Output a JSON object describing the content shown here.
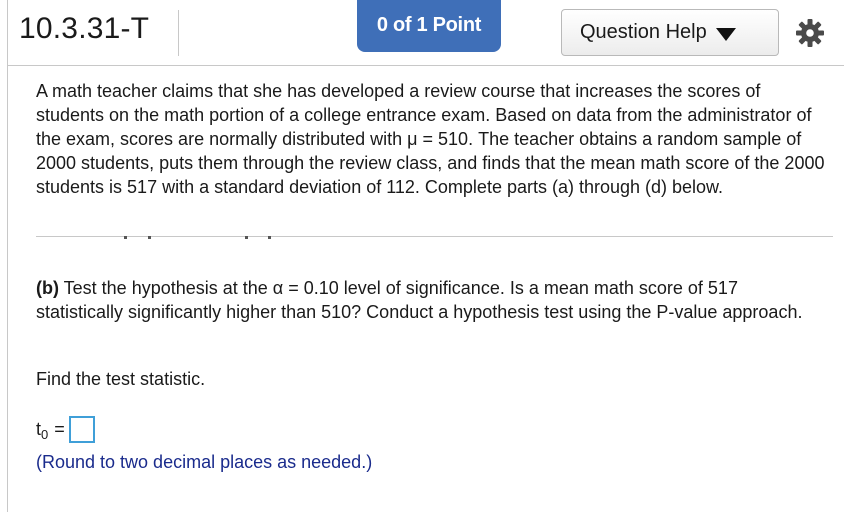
{
  "header": {
    "question_id": "10.3.31-T",
    "points": "0 of 1 Point",
    "help_label": "Question Help",
    "help_icon": "caret-down-icon",
    "settings_icon": "gear-icon"
  },
  "problem": {
    "text": "A math teacher claims that she has developed a review course that increases the scores of students on the math portion of a college entrance exam. Based on data from the administrator of the exam, scores are normally distributed with μ = 510. The teacher obtains a random sample of 2000 students, puts them through the review class, and finds that the mean math score of the 2000 students is 517 with a standard deviation of 112. Complete parts (a) through (d) below."
  },
  "part_b": {
    "label": "(b)",
    "text": " Test the hypothesis at the α = 0.10 level of significance. Is a mean math score of 517 statistically significantly higher than 510? Conduct a hypothesis test using the P-value approach."
  },
  "instruction": "Find the test statistic.",
  "answer": {
    "symbol": "t",
    "subscript": "0",
    "equals": "=",
    "value": ""
  },
  "note": "(Round to two decimal places as needed.)",
  "colors": {
    "accent": "#3f6fb8",
    "input_border": "#3f9fd8",
    "note_text": "#1a2b8c"
  }
}
